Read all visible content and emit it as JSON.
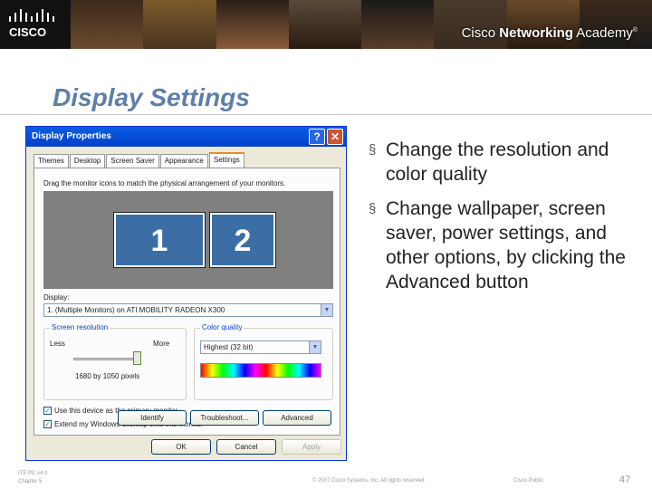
{
  "banner": {
    "logo_text": "CISCO",
    "academy_prefix": "Cisco ",
    "academy_bold": "Networking",
    "academy_suffix": " Academy",
    "academy_mark": "®"
  },
  "slide": {
    "title": "Display Settings",
    "bullets": [
      "Change the resolution and color quality",
      "Change wallpaper, screen saver, power settings, and other options, by clicking the Advanced button"
    ]
  },
  "dialog": {
    "title": "Display Properties",
    "help_label": "?",
    "close_label": "✕",
    "tabs": [
      "Themes",
      "Desktop",
      "Screen Saver",
      "Appearance",
      "Settings"
    ],
    "active_tab": "Settings",
    "instruction": "Drag the monitor icons to match the physical arrangement of your monitors.",
    "monitors": [
      "1",
      "2"
    ],
    "display_label": "Display:",
    "display_value": "1. (Multiple Monitors) on ATI MOBILITY RADEON X300",
    "resolution_group": "Screen resolution",
    "resolution_less": "Less",
    "resolution_more": "More",
    "resolution_value": "1680 by 1050 pixels",
    "resolution_level": 1.0,
    "color_group": "Color quality",
    "color_value": "Highest (32 bit)",
    "check_primary": "Use this device as the primary monitor",
    "check_extend": "Extend my Windows desktop onto this monitor",
    "btn_identify": "Identify",
    "btn_troubleshoot": "Troubleshoot...",
    "btn_advanced": "Advanced",
    "btn_ok": "OK",
    "btn_cancel": "Cancel",
    "btn_apply": "Apply"
  },
  "footer": {
    "course": "ITE PC v4.0",
    "chapter": "Chapter 5",
    "copyright": "© 2007 Cisco Systems, Inc. All rights reserved.",
    "classification": "Cisco Public",
    "page": "47"
  }
}
